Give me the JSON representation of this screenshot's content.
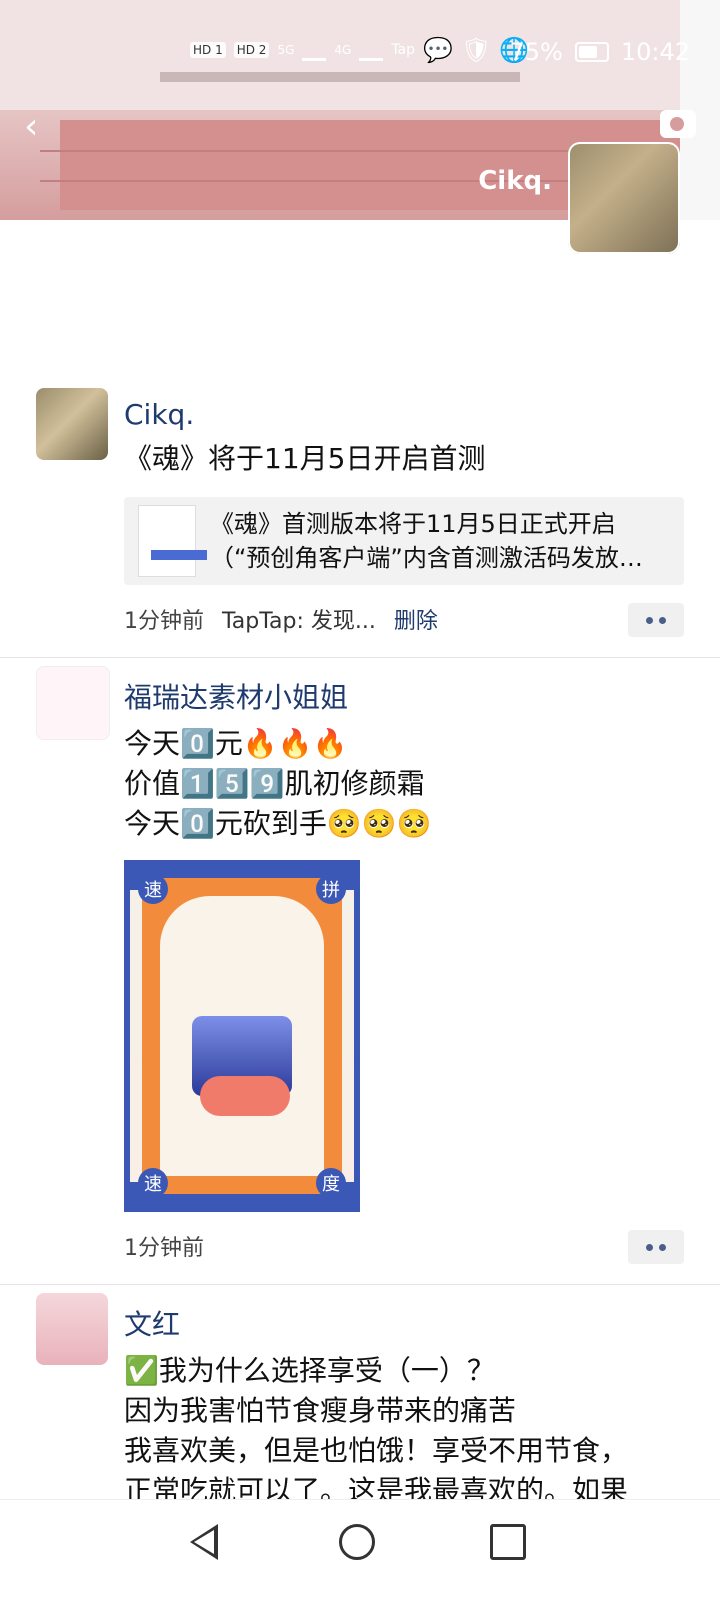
{
  "status_bar": {
    "sim1": "HD 1",
    "sim2": "HD 2",
    "net1": "5G",
    "net2": "4G",
    "tap": "Tap",
    "battery": "75%",
    "time": "10:42"
  },
  "profile": {
    "name": "Cikq."
  },
  "posts": [
    {
      "author": "Cikq.",
      "text": "《魂》将于11月5日开启首测",
      "share": {
        "title": "《魂》首测版本将于11月5日正式开启",
        "subtitle": "（“预创角客户端”内含首测激活码发放…"
      },
      "time": "1分钟前",
      "source": "TapTap: 发现...",
      "delete": "删除"
    },
    {
      "author": "福瑞达素材小姐姐",
      "text": "今天0️⃣元🔥🔥🔥\n价值1️⃣5️⃣9️⃣肌初修颜霜\n今天0️⃣元砍到手🥺🥺🥺",
      "poster": {
        "c1": "速",
        "c2": "拼",
        "c3": "速",
        "c4": "度"
      },
      "time": "1分钟前"
    },
    {
      "author": "文红",
      "text": "✅我为什么选择享受（一）？\n因为我害怕节食瘦身带来的痛苦\n我喜欢美，但是也怕饿！享受不用节食，\n正常吃就可以了。这是我最喜欢的。如果"
    }
  ]
}
